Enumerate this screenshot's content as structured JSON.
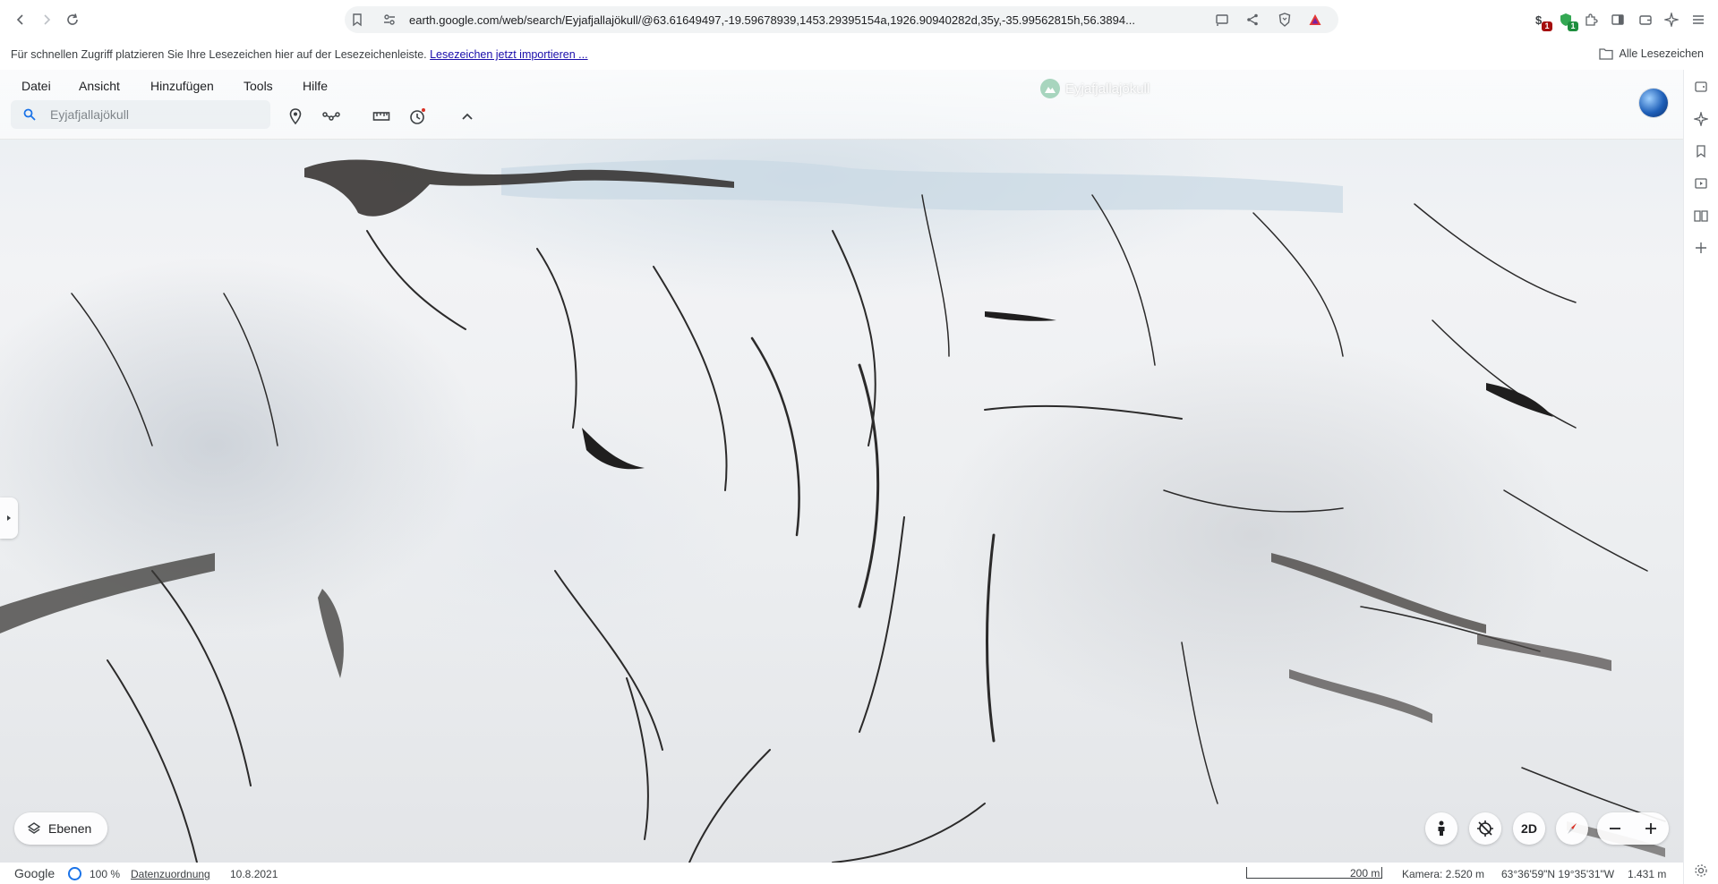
{
  "browser": {
    "url": "earth.google.com/web/search/Eyjafjallajökull/@63.61649497,-19.59678939,1453.29395154a,1926.90940282d,35y,-35.99562815h,56.3894...",
    "extensions": [
      {
        "name": "ext-counter-icon",
        "badge": "1",
        "badge_color": "#a50e0e"
      },
      {
        "name": "shield-ext-icon",
        "badge": "1",
        "badge_color": "#1e8e3e"
      }
    ],
    "bookmarks_hint": "Für schnellen Zugriff platzieren Sie Ihre Lesezeichen hier auf der Lesezeichenleiste.",
    "bookmarks_import_link": "Lesezeichen jetzt importieren ...",
    "all_bookmarks": "Alle Lesezeichen"
  },
  "earth": {
    "menu": [
      "Datei",
      "Ansicht",
      "Hinzufügen",
      "Tools",
      "Hilfe"
    ],
    "search_placeholder": "Eyjafjallajökull",
    "place_label": "Eyjafjallajökull",
    "layers_label": "Ebenen",
    "view_mode": "2D"
  },
  "status": {
    "brand": "Google",
    "load_progress": "100 %",
    "attribution": "Datenzuordnung",
    "imagery_date": "10.8.2021",
    "scale": "200 m",
    "camera": "Kamera: 2.520 m",
    "coordinates": "63°36'59\"N 19°35'31\"W",
    "elevation": "1.431 m"
  },
  "colors": {
    "accent": "#1a73e8",
    "link": "#1a0dab"
  }
}
